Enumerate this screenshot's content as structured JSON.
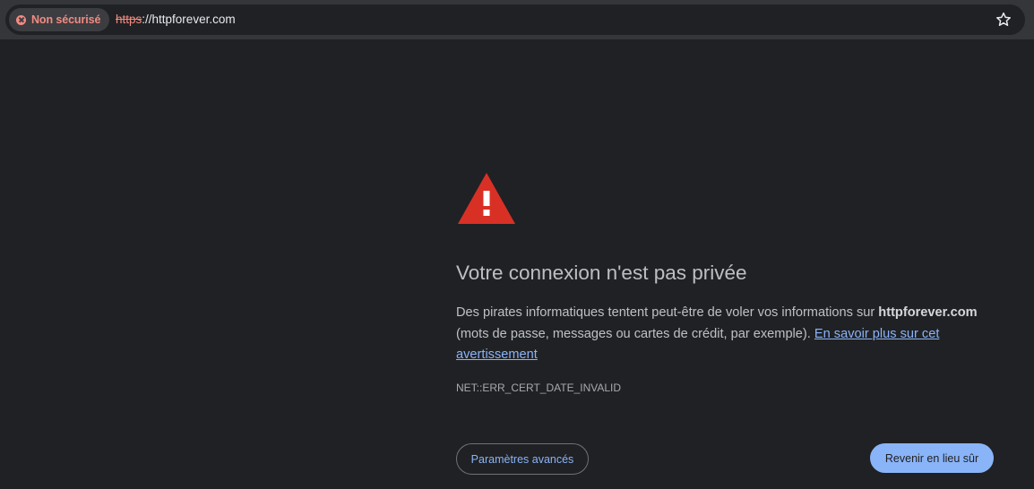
{
  "browser": {
    "security_chip": {
      "label": "Non sécurisé",
      "icon": "error-circle-icon"
    },
    "url": {
      "scheme": "https",
      "rest": "://httpforever.com"
    },
    "bookmark_icon": "star-icon"
  },
  "interstitial": {
    "icon": "warning-triangle-icon",
    "heading": "Votre connexion n'est pas privée",
    "message": {
      "part1": "Des pirates informatiques tentent peut-être de voler vos informations sur ",
      "domain": "httpforever.com",
      "part2": " (mots de passe, messages ou cartes de crédit, par exemple). ",
      "learn_more_link": "En savoir plus sur cet avertissement"
    },
    "error_code": "NET::ERR_CERT_DATE_INVALID",
    "advanced_button": "Paramètres avancés",
    "back_button": "Revenir en lieu sûr"
  },
  "colors": {
    "page_background": "#202124",
    "toolbar_background": "#35363a",
    "danger": "#f28b82",
    "link": "#8ab4f8",
    "warning_icon": "#d93025"
  }
}
